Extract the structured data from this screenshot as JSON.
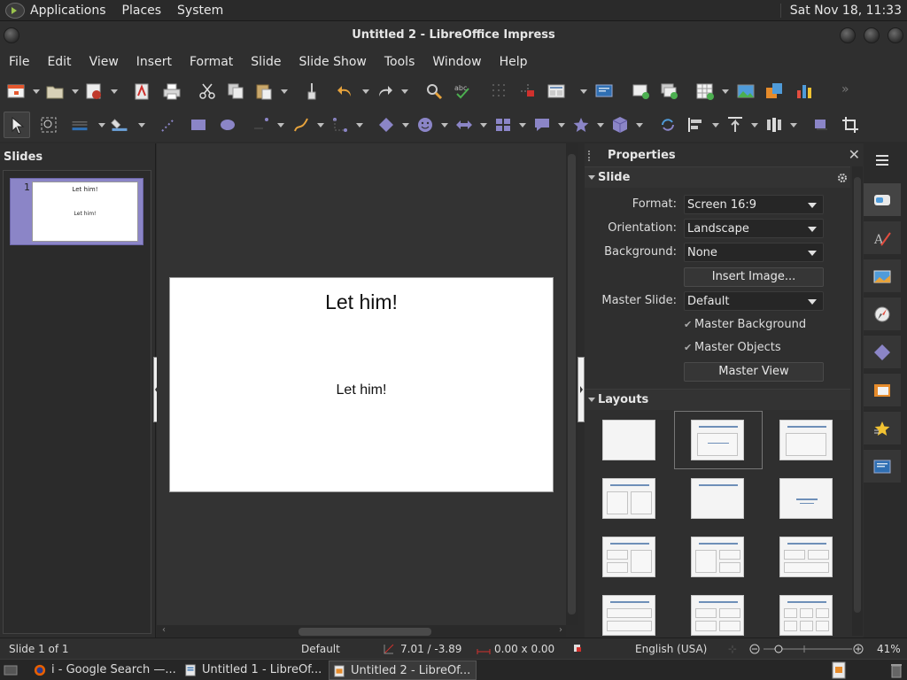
{
  "top_panel": {
    "menus": [
      "Applications",
      "Places",
      "System"
    ],
    "clock": "Sat Nov 18, 11:33"
  },
  "window": {
    "title": "Untitled 2 - LibreOffice Impress"
  },
  "menubar": [
    "File",
    "Edit",
    "View",
    "Insert",
    "Format",
    "Slide",
    "Slide Show",
    "Tools",
    "Window",
    "Help"
  ],
  "slides_pane": {
    "header": "Slides",
    "thumbnails": [
      {
        "number": "1",
        "title": "Let him!",
        "body": "Let him!"
      }
    ]
  },
  "slide": {
    "title": "Let him!",
    "body": "Let him!"
  },
  "properties": {
    "header": "Properties",
    "close_glyph": "✕",
    "slide_section": {
      "label": "Slide",
      "format_label": "Format:",
      "format_value": "Screen 16:9",
      "orientation_label": "Orientation:",
      "orientation_value": "Landscape",
      "background_label": "Background:",
      "background_value": "None",
      "insert_image": "Insert Image...",
      "master_slide_label": "Master Slide:",
      "master_slide_value": "Default",
      "master_background": "Master Background",
      "master_objects": "Master Objects",
      "master_view": "Master View"
    },
    "layouts_section": {
      "label": "Layouts"
    }
  },
  "status": {
    "slide_info": "Slide 1 of 1",
    "master": "Default",
    "position": "7.01 / -3.89",
    "size": "0.00 x 0.00",
    "language": "English (USA)",
    "zoom": "41%"
  },
  "taskbar": {
    "tasks": [
      {
        "label": "i - Google Search —..."
      },
      {
        "label": "Untitled 1 - LibreOf..."
      },
      {
        "label": "Untitled 2 - LibreOf..."
      }
    ]
  },
  "colors": {
    "selection": "#8b85c7",
    "layout_bar": "#6e8fb8",
    "accent_red": "#d0312d"
  }
}
